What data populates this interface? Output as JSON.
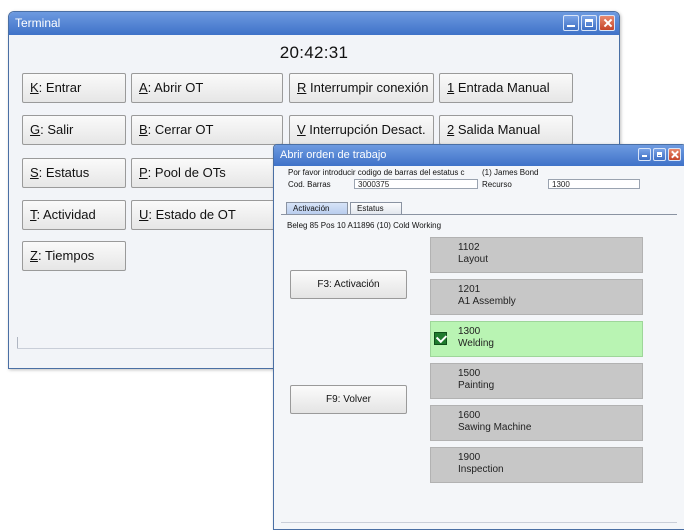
{
  "terminal": {
    "title": "Terminal",
    "clock": "20:42:31",
    "buttons": [
      {
        "hot": "K",
        "rest": ": Entrar"
      },
      {
        "hot": "A",
        "rest": ": Abrir OT"
      },
      {
        "hot": "R",
        "rest": " Interrumpir conexión"
      },
      {
        "hot": "1",
        "rest": " Entrada Manual"
      },
      {
        "hot": "G",
        "rest": ": Salir"
      },
      {
        "hot": "B",
        "rest": ": Cerrar OT"
      },
      {
        "hot": "V",
        "rest": " Interrupción Desact."
      },
      {
        "hot": "2",
        "rest": " Salida Manual"
      },
      {
        "hot": "S",
        "rest": ": Estatus"
      },
      {
        "hot": "P",
        "rest": ": Pool de OTs"
      },
      {
        "hot": "T",
        "rest": ": Actividad"
      },
      {
        "hot": "U",
        "rest": ": Estado de OT"
      },
      {
        "hot": "Z",
        "rest": ": Tiempos"
      }
    ]
  },
  "dialog": {
    "title": "Abrir orden de trabajo",
    "prompt": "Por favor introducir codigo de barras del estatus c",
    "user": "(1) James Bond",
    "barcode_label": "Cod. Barras",
    "barcode_value": "3000375",
    "resource_label": "Recurso",
    "resource_value": "1300",
    "tabs": [
      "Activación",
      "Estatus"
    ],
    "order_line": "Beleg 85  Pos 10 A11896 (10) Cold Working",
    "f3_label": "F3: Activación",
    "f9_label": "F9: Volver",
    "operations": [
      {
        "code": "1102",
        "name": "Layout",
        "active": false
      },
      {
        "code": "1201",
        "name": "A1 Assembly",
        "active": false
      },
      {
        "code": "1300",
        "name": "Welding",
        "active": true
      },
      {
        "code": "1500",
        "name": "Painting",
        "active": false
      },
      {
        "code": "1600",
        "name": "Sawing Machine",
        "active": false
      },
      {
        "code": "1900",
        "name": "Inspection",
        "active": false
      }
    ]
  },
  "colors": {
    "titlebar": "#3f72c8",
    "active_operation": "#b9f4b3",
    "inactive_operation": "#c7c7c7",
    "check": "#1f7a2e"
  }
}
